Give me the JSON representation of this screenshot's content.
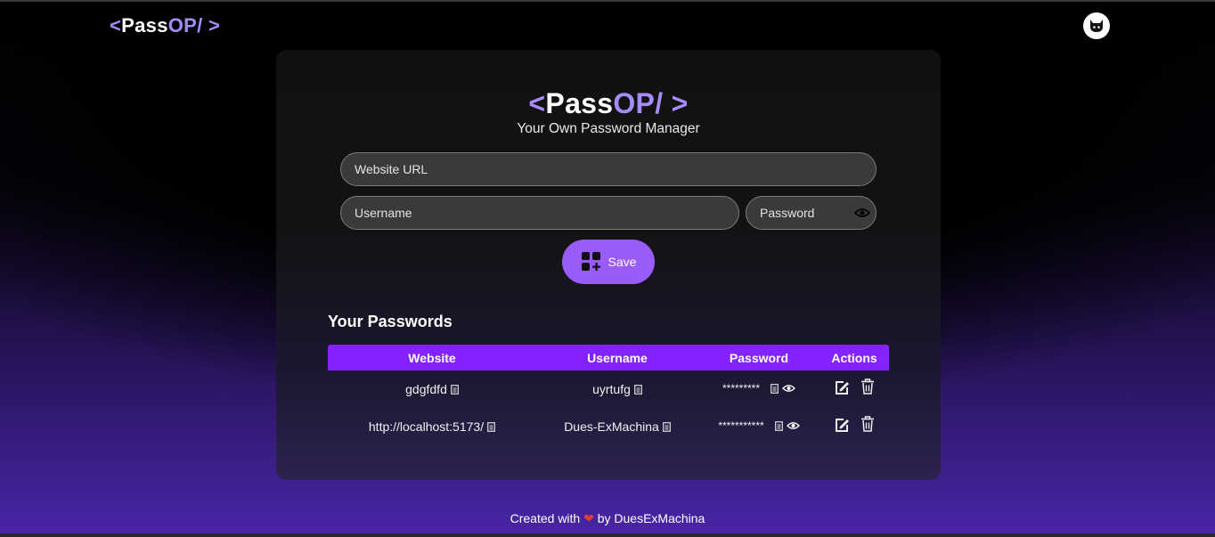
{
  "app": {
    "logo_open": "<",
    "logo_pass": "Pass",
    "logo_op": "OP/",
    "logo_close": " >"
  },
  "form": {
    "subtitle": "Your Own Password Manager",
    "url_placeholder": "Website URL",
    "username_placeholder": "Username",
    "password_placeholder": "Password",
    "save_label": "Save"
  },
  "passwords": {
    "heading": "Your Passwords",
    "columns": [
      "Website",
      "Username",
      "Password",
      "Actions"
    ],
    "rows": [
      {
        "website": "gdgfdfd",
        "username": "uyrtufg",
        "password": "*********"
      },
      {
        "website": "http://localhost:5173/",
        "username": "Dues-ExMachina",
        "password": "***********"
      }
    ]
  },
  "footer": {
    "created_with": "Created with",
    "heart": "❤",
    "by": "by DuesExMachina"
  },
  "icons": {
    "github": "github-icon",
    "eye": "eye-icon",
    "copy": "copy-icon",
    "edit": "edit-icon",
    "delete": "trash-icon",
    "save": "add-grid-icon"
  },
  "colors": {
    "accent": "#a78bfa",
    "header_bg": "#8423ff",
    "save_bg": "#9a5cf8"
  }
}
